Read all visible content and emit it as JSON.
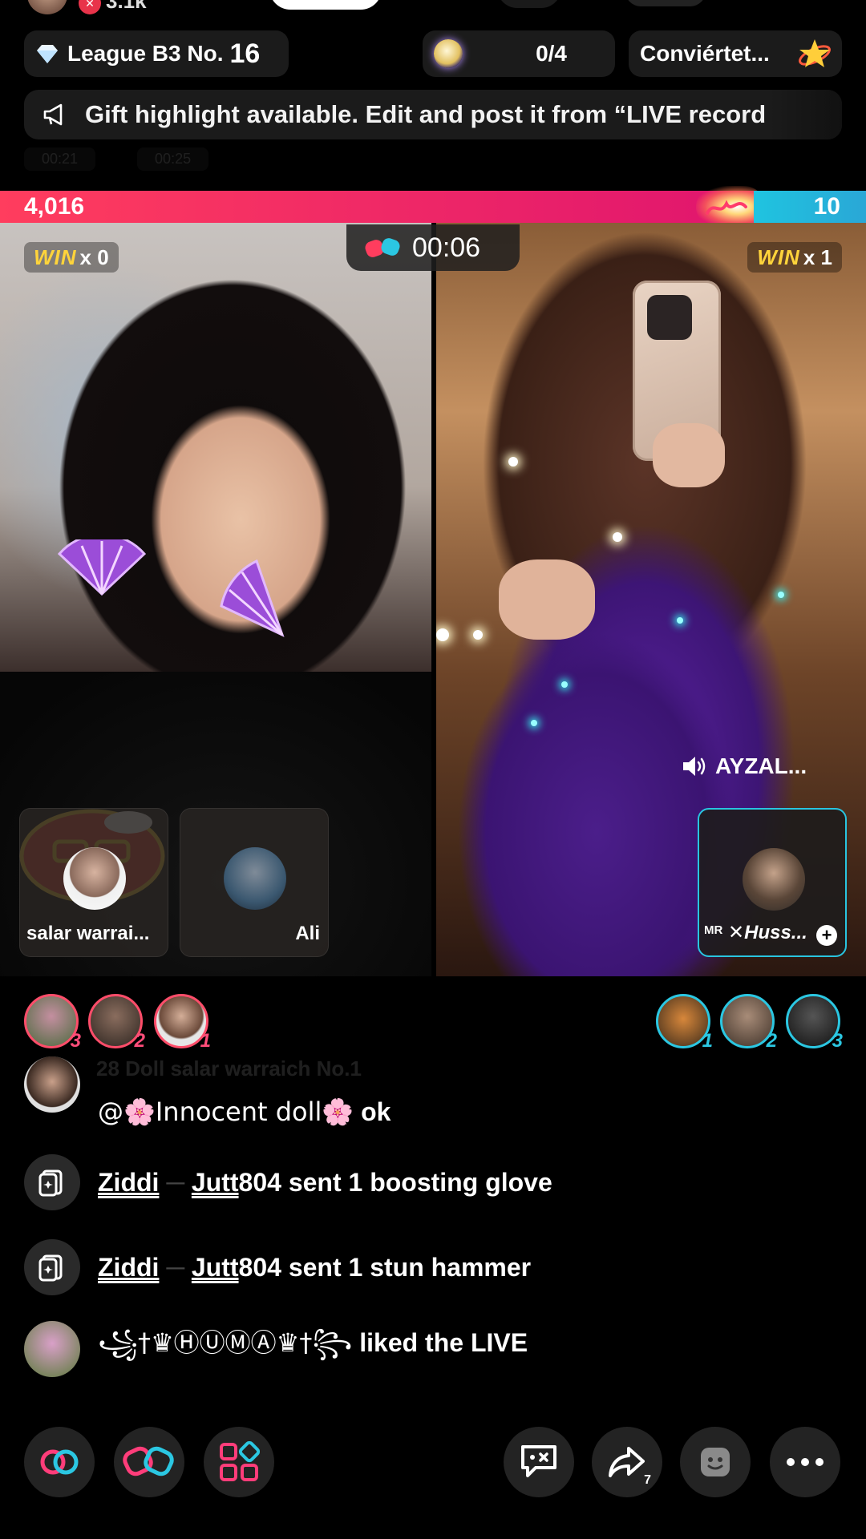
{
  "top": {
    "likes": "3.1k"
  },
  "league": {
    "label": "League B3 No.",
    "number": "16"
  },
  "progress": {
    "value": "0/4"
  },
  "convert": {
    "label": "Conviértet..."
  },
  "banner": {
    "text": "Gift highlight available. Edit and post it from “LIVE record"
  },
  "ghost_chips": [
    "00:21",
    "00:25"
  ],
  "battle": {
    "left_score": "4,016",
    "right_score": "10",
    "left_win": "x 0",
    "right_win": "x 1",
    "win_word": "WIN",
    "timer": "00:06",
    "left_share": 0.87
  },
  "speaker": {
    "name": "AYZAL..."
  },
  "guests": [
    {
      "name": "salar warrai..."
    },
    {
      "name": "Ali"
    },
    {
      "name_prefix": "MR",
      "name": "Huss..."
    }
  ],
  "rankings": {
    "left": [
      "3",
      "2",
      "1"
    ],
    "right": [
      "1",
      "2",
      "3"
    ]
  },
  "chat": {
    "ghost_line": "28  Doll  salar warraich  No.1",
    "messages": [
      {
        "mention": "@🌸Innocent doll🌸",
        "text": " ok"
      },
      {
        "user_a": "Ziddi",
        "sep": " ─ ",
        "user_b": "Jutt",
        "text": "804 sent 1 boosting glove"
      },
      {
        "user_a": "Ziddi",
        "sep": " ─ ",
        "user_b": "Jutt",
        "text": "804 sent 1 stun hammer"
      },
      {
        "user": "꧁†♛ⒽⓊⓂⒶ♛†꧂",
        "text": " liked the LIVE"
      }
    ]
  },
  "bottom_bar": {
    "share_count": "7"
  },
  "colors": {
    "red_team": "#e0156e",
    "blue_team": "#2bc7e2",
    "win_yellow": "#ffd43b"
  }
}
